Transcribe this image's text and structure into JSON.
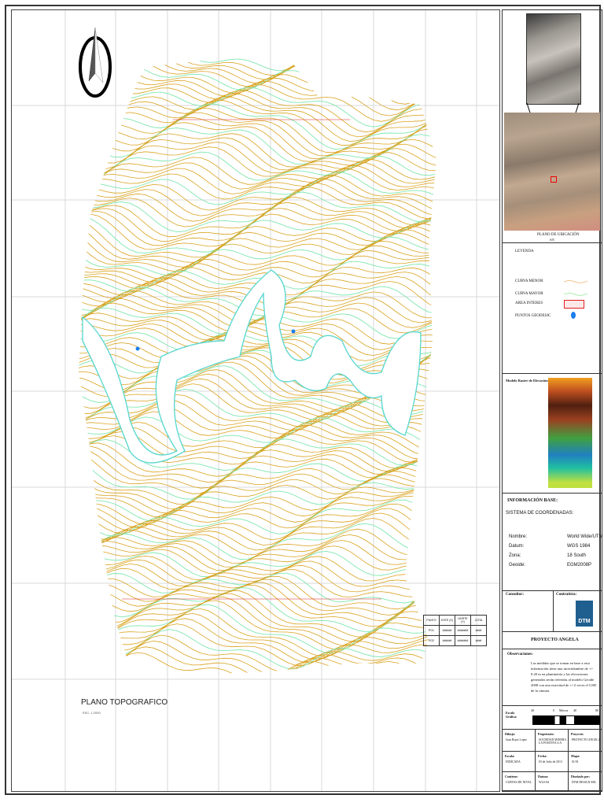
{
  "map": {
    "title": "PLANO TOPOGRAFICO",
    "scale": "ESC: 1:2000",
    "colors": {
      "minor_contour": "#d9a21f",
      "major_contour": "#7fe6b0",
      "river": "#5fd8d0",
      "grid": "#d8d8d8"
    },
    "points_table": {
      "headers": [
        "PUNTO",
        "ESTE (X)",
        "NORTE (Y)",
        "COTA"
      ],
      "rows": [
        [
          "PO1",
          "######",
          "#######",
          "####"
        ],
        [
          "PO2",
          "######",
          "#######",
          "####"
        ]
      ]
    }
  },
  "panel": {
    "location_title": "PLANO DE UBICACIÓN",
    "location_sub": "S/E",
    "legend": {
      "title": "LEYENDA",
      "items": [
        {
          "label": "CURVA MENOR",
          "color": "#f0b070"
        },
        {
          "label": "CURVA MAYOR",
          "color": "#90e890"
        },
        {
          "label": "AREA INTERES",
          "color": "#e02020"
        },
        {
          "label": "PUNTOS GEODESIC",
          "color": "#1a7ef0"
        }
      ]
    },
    "raster_title": "Modelo Raster de Elevación",
    "info": {
      "title": "INFORMACIÓN BASE:",
      "system_title": "SISTEMA DE COORDENADAS:",
      "rows": [
        {
          "key": "Nombre:",
          "value": "World Wide/UTM"
        },
        {
          "key": "Datum:",
          "value": "WGS 1984"
        },
        {
          "key": "Zona:",
          "value": "18 South"
        },
        {
          "key": "Geoide:",
          "value": "EGM2008P"
        }
      ]
    },
    "consultant_label": "Consultor:",
    "client_label": "Contratista:",
    "logo_text": "DTM",
    "project": "PROYECTO ANGELA",
    "observations_title": "Observaciones:",
    "observations": "Las medidas que se toman en base a esta información tiene una incertidumbre de +/- 0.20 m en planimetría y las elevaciones generadas serán referidas al modelo Geoide 2008 con una exactitud de +/-2 veces el GSD de la cámara.",
    "scale_label": "Escala Gráfica:",
    "scale_unit": "Metros",
    "scale_ticks": [
      "40",
      "0",
      "40",
      "80"
    ],
    "table": [
      [
        {
          "k": "Dibujo:",
          "v": "Juan Rojas Lopez"
        },
        {
          "k": "Propietario:",
          "v": "SOCIEDAD MINERA LA POSITIVA S.A"
        },
        {
          "k": "Proyecto:",
          "v": "PROYECTO ANGELA"
        }
      ],
      [
        {
          "k": "Escala:",
          "v": "INDICADA"
        },
        {
          "k": "Fecha:",
          "v": "03 de Julio de 2013"
        },
        {
          "k": "Mapa:",
          "v": "01/01"
        }
      ],
      [
        {
          "k": "Contiene:",
          "v": "CURVAS DE NIVEL"
        },
        {
          "k": "Datum:",
          "v": "WGS 84"
        },
        {
          "k": "Diseñado por:",
          "v": "DTM DESIGN SRL"
        }
      ]
    ]
  }
}
